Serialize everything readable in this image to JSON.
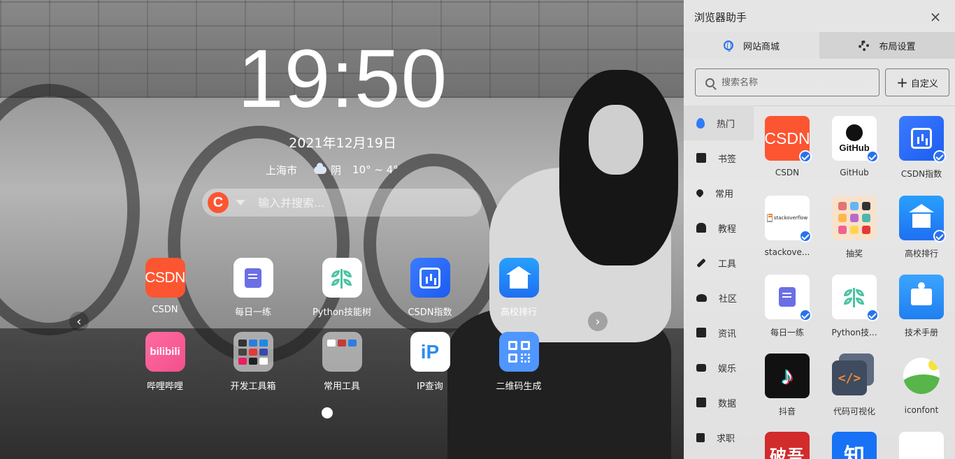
{
  "clock": {
    "time": "19:50",
    "date": "2021年12月19日"
  },
  "weather": {
    "city": "上海市",
    "icon": "cloud-icon",
    "condition": "阴",
    "temp": "10° ~ 4°"
  },
  "search": {
    "engine_icon": "C",
    "engine_color": "#fc5531",
    "placeholder": "输入并搜索..."
  },
  "apps": [
    {
      "label": "CSDN",
      "icon": "csdn-logo-icon",
      "icon_text": "CSDN"
    },
    {
      "label": "每日一练",
      "icon": "daily-practice-icon"
    },
    {
      "label": "Python技能树",
      "icon": "skill-tree-icon"
    },
    {
      "label": "CSDN指数",
      "icon": "csdn-index-icon"
    },
    {
      "label": "高校排行",
      "icon": "university-rank-icon"
    },
    {
      "label": "哔哩哔哩",
      "icon": "bilibili-icon",
      "icon_text": "bilibili"
    },
    {
      "label": "开发工具箱",
      "icon": "dev-toolbox-folder-icon"
    },
    {
      "label": "常用工具",
      "icon": "common-tools-folder-icon"
    },
    {
      "label": "IP查询",
      "icon": "ip-query-icon",
      "icon_text": "iP"
    },
    {
      "label": "二维码生成",
      "icon": "qrcode-icon"
    }
  ],
  "pager": {
    "prev": "‹",
    "next": "›"
  },
  "panel": {
    "title": "浏览器助手",
    "close": "×",
    "tabs": [
      {
        "label": "网站商城",
        "icon": "globe-icon"
      },
      {
        "label": "布局设置",
        "icon": "gear-icon"
      }
    ],
    "search_placeholder": "搜索名称",
    "custom_label": "自定义",
    "custom_plus": "+",
    "categories": [
      {
        "label": "热门",
        "icon": "fire-icon"
      },
      {
        "label": "书签",
        "icon": "bookmark-icon"
      },
      {
        "label": "常用",
        "icon": "heart-icon"
      },
      {
        "label": "教程",
        "icon": "user-icon"
      },
      {
        "label": "工具",
        "icon": "wrench-icon"
      },
      {
        "label": "社区",
        "icon": "people-icon"
      },
      {
        "label": "资讯",
        "icon": "news-icon"
      },
      {
        "label": "娱乐",
        "icon": "video-icon"
      },
      {
        "label": "数据",
        "icon": "chart-icon"
      },
      {
        "label": "求职",
        "icon": "job-icon"
      }
    ],
    "sites": [
      {
        "label": "CSDN",
        "icon_text": "CSDN",
        "added": true
      },
      {
        "label": "GitHub",
        "icon_text": "GitHub",
        "added": true
      },
      {
        "label": "CSDN指数",
        "added": true
      },
      {
        "label": "stackove...",
        "icon_text": "stackoverflow",
        "added": true
      },
      {
        "label": "抽奖",
        "added": false
      },
      {
        "label": "高校排行",
        "added": true
      },
      {
        "label": "每日一练",
        "added": true
      },
      {
        "label": "Python技...",
        "added": true
      },
      {
        "label": "技术手册",
        "added": false
      },
      {
        "label": "抖音",
        "icon_text": "♪",
        "added": false
      },
      {
        "label": "代码可视化",
        "icon_text": "</>",
        "added": false
      },
      {
        "label": "iconfont",
        "added": false
      },
      {
        "label": "",
        "icon_text": "破吾",
        "added": false
      },
      {
        "label": "",
        "icon_text": "知",
        "added": false
      },
      {
        "label": "",
        "added": false
      }
    ]
  }
}
